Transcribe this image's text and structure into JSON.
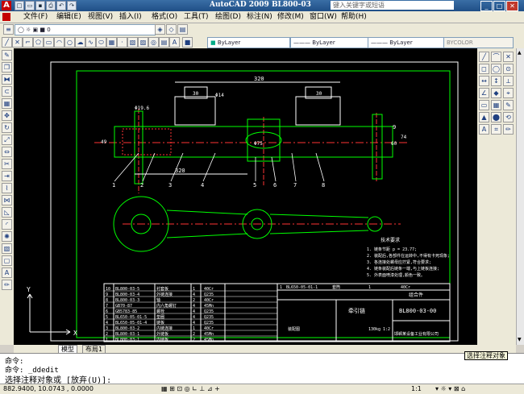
{
  "app": {
    "title": "AutoCAD 2009  BL800-03",
    "logo": "A"
  },
  "search": {
    "placeholder": "键入关键字或短语"
  },
  "menu": [
    "文件(F)",
    "编辑(E)",
    "视图(V)",
    "插入(I)",
    "格式(O)",
    "工具(T)",
    "绘图(D)",
    "标注(N)",
    "修改(M)",
    "窗口(W)",
    "帮助(H)"
  ],
  "props": {
    "color": "ByLayer",
    "linetype": "ByLayer",
    "lineweight": "ByLayer",
    "plotstyle": "BYCOLOR"
  },
  "tabs": [
    "模型",
    "布局1"
  ],
  "command": {
    "line1": "命令:",
    "line2": "命令:  _ddedit",
    "line3": "选择注释对象或 [放弃(U)]:"
  },
  "tooltip": "选择注释对象",
  "status": {
    "coords": "882.9400, 10.0743 , 0.0000",
    "scale": "1:1"
  },
  "drawing": {
    "dims": {
      "top": "320",
      "mid": "320",
      "phi14": "Φ14",
      "phi75": "Φ75",
      "phi196": "Φ19.6",
      "d30a": "30",
      "d30b": "30",
      "d60": "60",
      "d74": "74",
      "d108": "108",
      "d49": "49"
    },
    "leaders": [
      "1",
      "2",
      "3",
      "4",
      "5",
      "6",
      "7",
      "8",
      "9"
    ],
    "tech_title": "技术要求",
    "tech_notes": [
      "1. 链条节距 p = 23.77;",
      "2. 装配后,各部件在运转中,不得有卡死现象;",
      "3. 各连接处螺母应拧紧,符合要求;",
      "4. 链条装配后链条一端,与上链板连接;",
      "5. 外表面喷漆处理,颜色一致。"
    ],
    "bom": [
      [
        "10",
        "BL800-03-5",
        "衬套板",
        "1",
        "40Cr",
        ""
      ],
      [
        "9",
        "BL800-03-4",
        "外链连接",
        "4",
        "Q235",
        ""
      ],
      [
        "8",
        "BL800-03-3",
        "轴",
        "2",
        "40Cr",
        ""
      ],
      [
        "7",
        "GB70-87",
        "内六角螺钉",
        "4",
        "45Mn",
        ""
      ],
      [
        "6",
        "GB5783-85",
        "螺栓",
        "4",
        "Q235",
        ""
      ],
      [
        "5",
        "BL650-05-01-5",
        "垫圈",
        "4",
        "Q235",
        ""
      ],
      [
        "4",
        "BL650-05-01-4",
        "链板",
        "4",
        "Q235",
        ""
      ],
      [
        "3",
        "BL800-03-2",
        "内链连接",
        "1",
        "40Cr",
        ""
      ],
      [
        "2",
        "BL800-03-1",
        "外链板",
        "2",
        "45Mn",
        ""
      ],
      [
        "1",
        "BL800-03-1",
        "内链板",
        "2",
        "45Mn",
        ""
      ]
    ],
    "bom_right_row": [
      "1",
      "BL650-05-01-1",
      "套筒",
      "1",
      "40Cr"
    ],
    "title_block": {
      "name": "牵引链",
      "code": "BL800-03-00",
      "sub": "组合件",
      "company": "邯郸某设备工业有限公司",
      "weight": "130kg",
      "scale": "1:2",
      "drawing_note": "装配图"
    }
  }
}
